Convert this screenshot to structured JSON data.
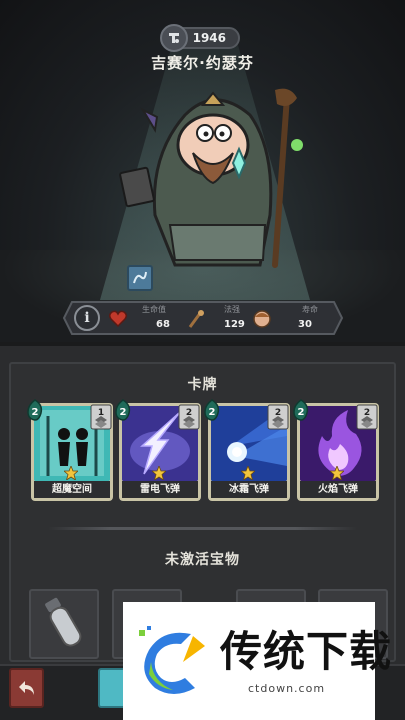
{
  "character": {
    "level": "1946",
    "name": "吉赛尔·约瑟芬"
  },
  "stats": {
    "hp_label": "生命值",
    "hp_value": "68",
    "power_label": "法强",
    "power_value": "129",
    "life_label": "寿命",
    "life_value": "30"
  },
  "sections": {
    "cards_title": "卡牌",
    "treasures_title": "未激活宝物"
  },
  "cards": [
    {
      "name": "超魔空间",
      "cost": "2",
      "level": "1",
      "icon": "shadow-figures-icon",
      "color": "#39b5b3"
    },
    {
      "name": "雷电飞弹",
      "cost": "2",
      "level": "2",
      "icon": "lightning-icon",
      "color": "#4a3fa8"
    },
    {
      "name": "冰霜飞弹",
      "cost": "2",
      "level": "2",
      "icon": "ice-comet-icon",
      "color": "#2b5fb8"
    },
    {
      "name": "火焰飞弹",
      "cost": "2",
      "level": "2",
      "icon": "purple-fire-icon",
      "color": "#5a2a8c"
    }
  ],
  "watermark": {
    "brand": "传统下载",
    "url": "ctdown.com"
  },
  "colors": {
    "card_frame": "#c9c4a6",
    "hp_red": "#c0392b",
    "teal_button": "#4fb9c4",
    "back_button": "#8a3a34"
  }
}
